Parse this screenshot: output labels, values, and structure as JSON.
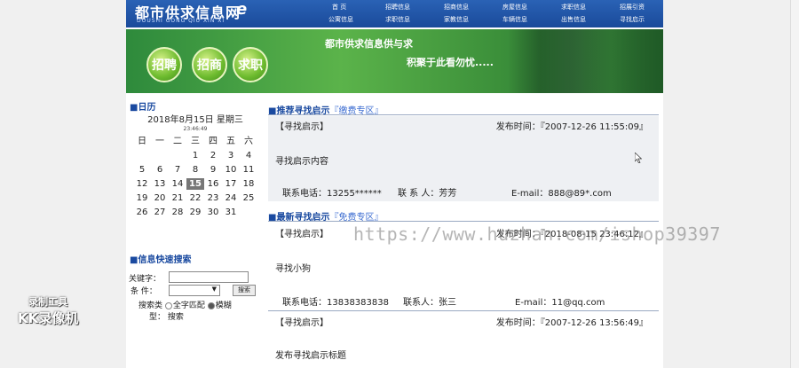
{
  "header": {
    "logo_main": "都市供求信息网",
    "logo_sub": "DOUSHI GONG QIU XIN XI",
    "logo_e": "e",
    "nav_row1": [
      "首  页",
      "招聘信息",
      "招商信息",
      "房屋信息",
      "求职信息",
      "招展引资"
    ],
    "nav_row2": [
      "公寓信息",
      "求职信息",
      "家教信息",
      "车辆信息",
      "出售信息",
      "寻找启示"
    ]
  },
  "banner": {
    "buttons": [
      "招聘",
      "招商",
      "求职"
    ],
    "title": "都市供求信息供与求",
    "subtitle": "积聚于此看勿忧....."
  },
  "calendar": {
    "title": "日历",
    "date_line": "2018年8月15日 星期三",
    "time": "23:46:49",
    "weekdays": [
      "日",
      "一",
      "二",
      "三",
      "四",
      "五",
      "六"
    ],
    "days": [
      "",
      "",
      "",
      "1",
      "2",
      "3",
      "4",
      "5",
      "6",
      "7",
      "8",
      "9",
      "10",
      "11",
      "12",
      "13",
      "14",
      "15",
      "16",
      "17",
      "18",
      "19",
      "20",
      "21",
      "22",
      "23",
      "24",
      "25",
      "26",
      "27",
      "28",
      "29",
      "30",
      "31",
      ""
    ],
    "today": "15"
  },
  "search": {
    "title": "信息快速搜索",
    "keyword_label": "关键字：",
    "condition_label": "条  件：",
    "search_button": "搜索",
    "type_label": "搜索类",
    "type_label2": "型：",
    "option_exact": "全字匹配",
    "option_fuzzy": "模糊",
    "option_search": "搜索"
  },
  "recommended": {
    "title": "推荐寻找启示",
    "tag": "『缴费专区』",
    "item": {
      "category": "【寻找启示】",
      "time": "发布时间：『2007-12-26 11:55:09』",
      "content": "寻找启示内容",
      "phone": "联系电话：13255******",
      "contact": "联 系 人：芳芳",
      "email": "E-mail：888@89*.com"
    }
  },
  "latest": {
    "title": "最新寻找启示",
    "tag": "『免费专区』",
    "items": [
      {
        "category": "【寻找启示】",
        "time": "发布时间：『2018-08-15 23:46:12』",
        "content": "寻找小狗",
        "phone": "联系电话：13838383838",
        "contact": "联系人：张三",
        "email": "E-mail：11@qq.com"
      },
      {
        "category": "【寻找启示】",
        "time": "发布时间：『2007-12-26 13:56:49』",
        "content": "发布寻找启示标题"
      }
    ]
  },
  "overlay": {
    "watermark": "https://www.huzhan.com/ishop39397",
    "recorder_line1": "录制工具",
    "recorder_line2": "KK录像机"
  }
}
